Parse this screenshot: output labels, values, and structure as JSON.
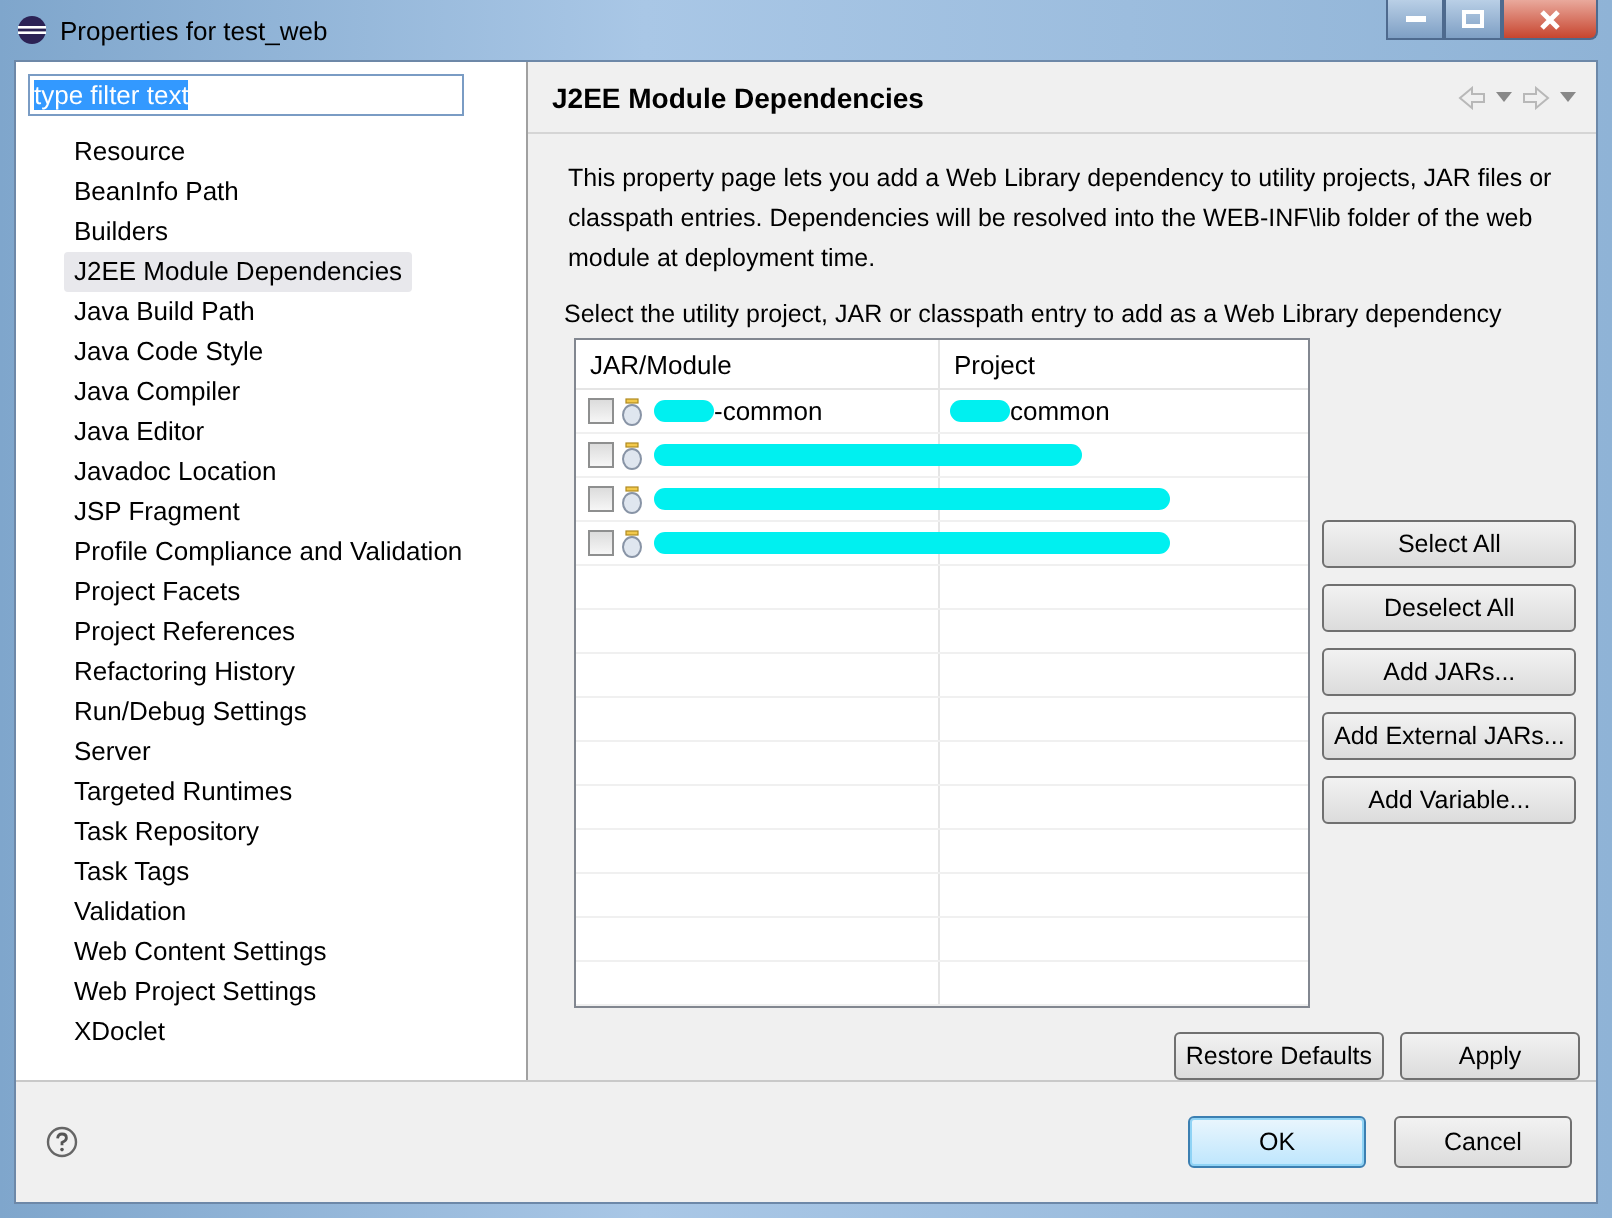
{
  "window": {
    "title": "Properties for test_web"
  },
  "filter": {
    "value": "type filter text"
  },
  "sidebar": {
    "items": [
      {
        "label": "Resource",
        "selected": false
      },
      {
        "label": "BeanInfo Path",
        "selected": false
      },
      {
        "label": "Builders",
        "selected": false
      },
      {
        "label": "J2EE Module Dependencies",
        "selected": true
      },
      {
        "label": "Java Build Path",
        "selected": false
      },
      {
        "label": "Java Code Style",
        "selected": false
      },
      {
        "label": "Java Compiler",
        "selected": false
      },
      {
        "label": "Java Editor",
        "selected": false
      },
      {
        "label": "Javadoc Location",
        "selected": false
      },
      {
        "label": "JSP Fragment",
        "selected": false
      },
      {
        "label": "Profile Compliance and Validation",
        "selected": false
      },
      {
        "label": "Project Facets",
        "selected": false
      },
      {
        "label": "Project References",
        "selected": false
      },
      {
        "label": "Refactoring History",
        "selected": false
      },
      {
        "label": "Run/Debug Settings",
        "selected": false
      },
      {
        "label": "Server",
        "selected": false
      },
      {
        "label": "Targeted Runtimes",
        "selected": false
      },
      {
        "label": "Task Repository",
        "selected": false
      },
      {
        "label": "Task Tags",
        "selected": false
      },
      {
        "label": "Validation",
        "selected": false
      },
      {
        "label": "Web Content Settings",
        "selected": false
      },
      {
        "label": "Web Project Settings",
        "selected": false
      },
      {
        "label": "XDoclet",
        "selected": false
      }
    ]
  },
  "page": {
    "title": "J2EE Module Dependencies",
    "description": "This property page lets you add a Web Library dependency to utility projects, JAR files or classpath entries. Dependencies will be resolved into the WEB-INF\\lib folder of the web module at deployment time.",
    "instruction": "Select the utility project, JAR or classpath entry to add as a Web Library dependency"
  },
  "table": {
    "columns": [
      "JAR/Module",
      "Project"
    ],
    "rows": [
      {
        "checked": false,
        "module": {
          "text": "-common",
          "redacted": true
        },
        "project": {
          "text": "common",
          "redacted": true
        }
      },
      {
        "checked": false,
        "module": {
          "redacted": true
        },
        "project": {
          "redacted": true
        }
      },
      {
        "checked": false,
        "module": {
          "redacted": true
        },
        "project": {
          "redacted": true
        }
      },
      {
        "checked": false,
        "module": {
          "redacted": true
        },
        "project": {
          "redacted": true
        }
      }
    ]
  },
  "side_buttons": [
    "Select All",
    "Deselect All",
    "Add JARs...",
    "Add External JARs...",
    "Add Variable..."
  ],
  "page_buttons": [
    "Restore Defaults",
    "Apply"
  ],
  "dialog_buttons": [
    {
      "label": "OK",
      "kind": "default"
    },
    {
      "label": "Cancel",
      "kind": "normal"
    }
  ]
}
